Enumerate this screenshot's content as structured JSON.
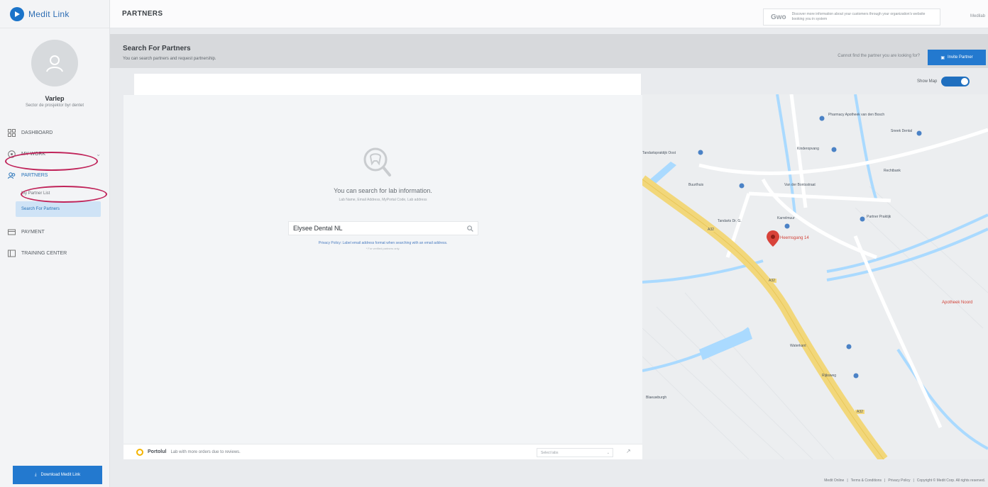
{
  "brand": {
    "name": "Medit Link"
  },
  "user": {
    "name": "Varlep",
    "subtitle": "Sector de prosjektor byr dentet"
  },
  "nav": {
    "items": [
      {
        "label": "DASHBOARD"
      },
      {
        "label": "MY WORK"
      },
      {
        "label": "PARTNERS"
      },
      {
        "label": "PAYMENT"
      },
      {
        "label": "TRAINING CENTER"
      }
    ],
    "partners_sub": [
      {
        "label": "My Partner List"
      },
      {
        "label": "Search For Partners"
      }
    ]
  },
  "download_button": "Download Medit Link",
  "topbar": {
    "title": "PARTNERS",
    "promo_text": "Discover more information about your customers through your organization's website booking you in system",
    "promo_logo": "Gwo",
    "right_label": "Medilab"
  },
  "header": {
    "title": "Search For Partners",
    "subtitle": "You can search partners and request partnership.",
    "link": "Cannot find the partner you are looking for?",
    "invite_button": "Invite Partner"
  },
  "show_map": {
    "label": "Show Map",
    "on": true
  },
  "empty": {
    "title": "You can search for lab information.",
    "subtitle": "Lab Name, Email Address, MyPortal Code, Lab address"
  },
  "search": {
    "value": "Elysee Dental NL",
    "placeholder": "Search"
  },
  "policy": {
    "text": "Privacy Policy: Label email address format when searching with an email address.",
    "sub": "* For verified partners only."
  },
  "powered": {
    "name": "Portolul",
    "text": "Lab with more orders due to reviews.",
    "select": "Select labs"
  },
  "map": {
    "labels": [
      "Pharmacy Apotheek van den Bosch",
      "Sneek Dental",
      "Tandartspraktijk Oost",
      "Kinderopvang",
      "Rechtbank",
      "Van der Bontsstraat",
      "Buurthuis",
      "Karrelmuur",
      "Tandarts Dr. G.",
      "Partner Praktijk",
      "Heemsgang 14",
      "Waterkant",
      "Apotheek Noord",
      "Rijksweg",
      "Blaeuwburgh",
      "A32",
      "A32",
      "A32"
    ]
  },
  "footer": {
    "links": [
      "Medit Online",
      "Terms & Conditions",
      "Privacy Policy",
      "Copyright © Medit Corp. All rights reserved."
    ]
  },
  "colors": {
    "accent": "#2379cf",
    "annotation": "#c0245a",
    "road": "#f2d77a",
    "water": "#aadaff"
  }
}
